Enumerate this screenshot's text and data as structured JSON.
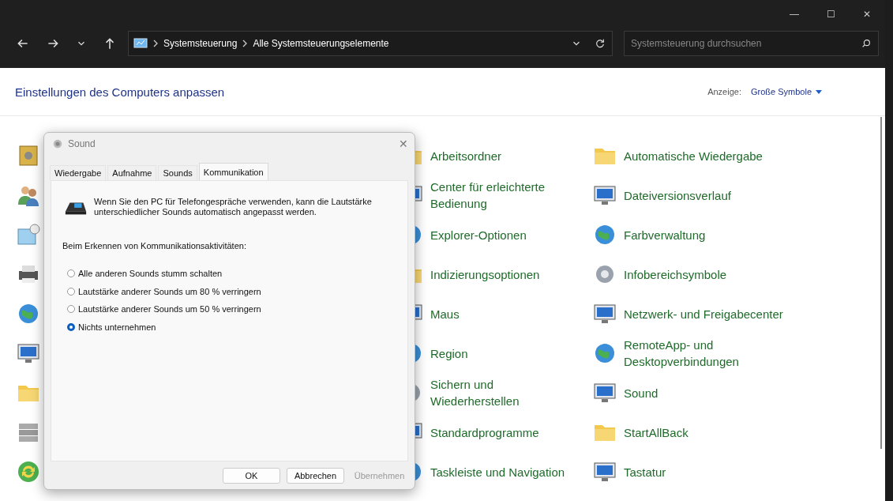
{
  "window": {
    "controls": [
      "—",
      "☐",
      "✕"
    ]
  },
  "address_bar": {
    "breadcrumbs": [
      "Systemsteuerung",
      "Alle Systemsteuerungselemente"
    ]
  },
  "search": {
    "placeholder": "Systemsteuerung durchsuchen"
  },
  "header": {
    "title": "Einstellungen des Computers anpassen",
    "view_label": "Anzeige:",
    "view_value": "Große Symbole"
  },
  "items": [
    {
      "cells": [
        {
          "label": "Arbeitsordner"
        },
        {
          "label": "Automatische Wiedergabe"
        }
      ]
    },
    {
      "cells": [
        {
          "label": "Center für erleichterte Bedienung"
        },
        {
          "label": "Dateiversionsverlauf"
        }
      ]
    },
    {
      "cells": [
        {
          "label": "Explorer-Optionen"
        },
        {
          "label": "Farbverwaltung"
        }
      ]
    },
    {
      "cells": [
        {
          "label": "Indizierungsoptionen"
        },
        {
          "label": "Infobereichsymbole"
        }
      ]
    },
    {
      "cells": [
        {
          "label": "Maus"
        },
        {
          "label": "Netzwerk- und Freigabecenter"
        }
      ]
    },
    {
      "cells": [
        {
          "label": "Region"
        },
        {
          "label": "RemoteApp- und Desktopverbindungen"
        }
      ]
    },
    {
      "cells": [
        {
          "label": "Sichern und Wiederherstellen"
        },
        {
          "label": "Sound"
        }
      ]
    },
    {
      "cells": [
        {
          "label": "Standardprogramme"
        },
        {
          "label": "StartAllBack"
        }
      ]
    },
    {
      "cells": [
        {
          "label": "Taskleiste und Navigation"
        },
        {
          "label": "Tastatur"
        }
      ]
    }
  ],
  "dialog": {
    "title": "Sound",
    "close": "✕",
    "tabs": [
      {
        "label": "Wiedergabe",
        "selected": false
      },
      {
        "label": "Aufnahme",
        "selected": false
      },
      {
        "label": "Sounds",
        "selected": false
      },
      {
        "label": "Kommunikation",
        "selected": true
      }
    ],
    "intro": "Wenn Sie den PC für Telefongespräche verwenden, kann die Lautstärke unterschiedlicher Sounds automatisch angepasst werden.",
    "prompt": "Beim Erkennen von Kommunikationsaktivitäten:",
    "options": [
      {
        "label": "Alle anderen Sounds stumm schalten",
        "selected": false
      },
      {
        "label": "Lautstärke anderer Sounds um 80 % verringern",
        "selected": false
      },
      {
        "label": "Lautstärke anderer Sounds um 50 % verringern",
        "selected": false
      },
      {
        "label": "Nichts unternehmen",
        "selected": true
      }
    ],
    "buttons": [
      {
        "label": "OK",
        "disabled": false
      },
      {
        "label": "Abbrechen",
        "disabled": false
      },
      {
        "label": "Übernehmen",
        "disabled": true
      }
    ]
  }
}
